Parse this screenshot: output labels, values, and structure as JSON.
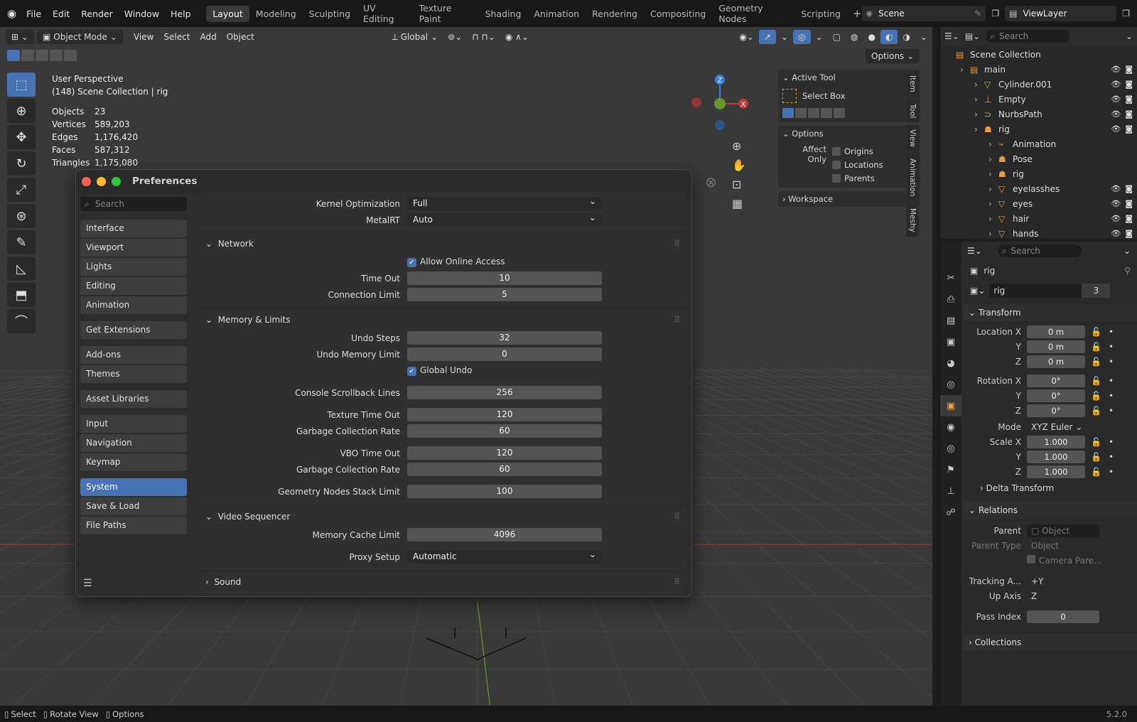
{
  "topbar": {
    "menus": [
      "File",
      "Edit",
      "Render",
      "Window",
      "Help"
    ],
    "workspaces": [
      "Layout",
      "Modeling",
      "Sculpting",
      "UV Editing",
      "Texture Paint",
      "Shading",
      "Animation",
      "Rendering",
      "Compositing",
      "Geometry Nodes",
      "Scripting"
    ],
    "active_workspace": "Layout",
    "scene": "Scene",
    "view_layer": "ViewLayer",
    "add_symbol": "+"
  },
  "viewport": {
    "mode": "Object Mode",
    "menus": [
      "View",
      "Select",
      "Add",
      "Object"
    ],
    "orientation": "Global",
    "options_label": "Options",
    "perspective": "User Perspective",
    "collection_line": "(148) Scene Collection | rig",
    "stats": [
      {
        "k": "Objects",
        "v": "23"
      },
      {
        "k": "Vertices",
        "v": "589,203"
      },
      {
        "k": "Edges",
        "v": "1,176,420"
      },
      {
        "k": "Faces",
        "v": "587,312"
      },
      {
        "k": "Triangles",
        "v": "1,175,080"
      }
    ],
    "gizmo": {
      "z": "Z",
      "x": "X"
    }
  },
  "npanel": {
    "active_tool_title": "Active Tool",
    "tool_name": "Select Box",
    "options_title": "Options",
    "affect_only": "Affect Only",
    "affect_items": [
      "Origins",
      "Locations",
      "Parents"
    ],
    "workspace_title": "Workspace",
    "tabs": [
      "Item",
      "Tool",
      "View",
      "Animation",
      "Meshy"
    ]
  },
  "outliner": {
    "search_placeholder": "Search",
    "rows": [
      {
        "label": "Scene Collection",
        "indent": 0
      },
      {
        "label": "main",
        "indent": 1
      },
      {
        "label": "Cylinder.001",
        "indent": 2
      },
      {
        "label": "Empty",
        "indent": 2
      },
      {
        "label": "NurbsPath",
        "indent": 2
      },
      {
        "label": "rig",
        "indent": 2
      },
      {
        "label": "Animation",
        "indent": 3
      },
      {
        "label": "Pose",
        "indent": 3
      },
      {
        "label": "rig",
        "indent": 3
      },
      {
        "label": "eyelasshes",
        "indent": 3
      },
      {
        "label": "eyes",
        "indent": 3
      },
      {
        "label": "hair",
        "indent": 3
      },
      {
        "label": "hands",
        "indent": 3
      }
    ]
  },
  "properties": {
    "search_placeholder": "Search",
    "object_name": "rig",
    "data_name": "rig",
    "users": "3",
    "transform_title": "Transform",
    "location": [
      {
        "l": "Location X",
        "v": "0 m"
      },
      {
        "l": "Y",
        "v": "0 m"
      },
      {
        "l": "Z",
        "v": "0 m"
      }
    ],
    "rotation": [
      {
        "l": "Rotation X",
        "v": "0°"
      },
      {
        "l": "Y",
        "v": "0°"
      },
      {
        "l": "Z",
        "v": "0°"
      }
    ],
    "mode_label": "Mode",
    "mode_value": "XYZ Euler",
    "scale": [
      {
        "l": "Scale X",
        "v": "1.000"
      },
      {
        "l": "Y",
        "v": "1.000"
      },
      {
        "l": "Z",
        "v": "1.000"
      }
    ],
    "delta_title": "Delta Transform",
    "relations_title": "Relations",
    "parent_label": "Parent",
    "parent_placeholder": "Object",
    "parent_type_label": "Parent Type",
    "parent_type_value": "Object",
    "camera_parent": "Camera Pare...",
    "tracking_label": "Tracking A...",
    "tracking_value": "+Y",
    "up_axis_label": "Up Axis",
    "up_axis_value": "Z",
    "pass_index_label": "Pass Index",
    "pass_index_value": "0",
    "collections_title": "Collections"
  },
  "status": {
    "items": [
      "Select",
      "Rotate View",
      "Options"
    ],
    "version": "5.2.0"
  },
  "prefs": {
    "title": "Preferences",
    "search_placeholder": "Search",
    "categories": [
      [
        "Interface",
        "Viewport",
        "Lights",
        "Editing",
        "Animation"
      ],
      [
        "Get Extensions"
      ],
      [
        "Add-ons",
        "Themes"
      ],
      [
        "Asset Libraries"
      ],
      [
        "Input",
        "Navigation",
        "Keymap"
      ],
      [
        "System",
        "Save & Load",
        "File Paths"
      ]
    ],
    "selected": "System",
    "top_rows": [
      {
        "label": "Kernel Optimization",
        "value": "Full",
        "type": "select"
      },
      {
        "label": "MetalRT",
        "value": "Auto",
        "type": "select"
      }
    ],
    "network": {
      "title": "Network",
      "allow_online": "Allow Online Access",
      "rows": [
        {
          "label": "Time Out",
          "value": "10"
        },
        {
          "label": "Connection Limit",
          "value": "5"
        }
      ]
    },
    "memory": {
      "title": "Memory & Limits",
      "undo_steps": {
        "label": "Undo Steps",
        "value": "32"
      },
      "undo_memory": {
        "label": "Undo Memory Limit",
        "value": "0"
      },
      "global_undo": "Global Undo",
      "console": {
        "label": "Console Scrollback Lines",
        "value": "256"
      },
      "texture_timeout": {
        "label": "Texture Time Out",
        "value": "120"
      },
      "gc_rate1": {
        "label": "Garbage Collection Rate",
        "value": "60"
      },
      "vbo_timeout": {
        "label": "VBO Time Out",
        "value": "120"
      },
      "gc_rate2": {
        "label": "Garbage Collection Rate",
        "value": "60"
      },
      "gn_stack": {
        "label": "Geometry Nodes Stack Limit",
        "value": "100"
      }
    },
    "video": {
      "title": "Video Sequencer",
      "cache": {
        "label": "Memory Cache Limit",
        "value": "4096"
      },
      "proxy": {
        "label": "Proxy Setup",
        "value": "Automatic"
      }
    },
    "sound_title": "Sound"
  },
  "colors": {
    "accent": "#4772b3",
    "bg": "#393939",
    "panel": "#2d2d2d"
  }
}
